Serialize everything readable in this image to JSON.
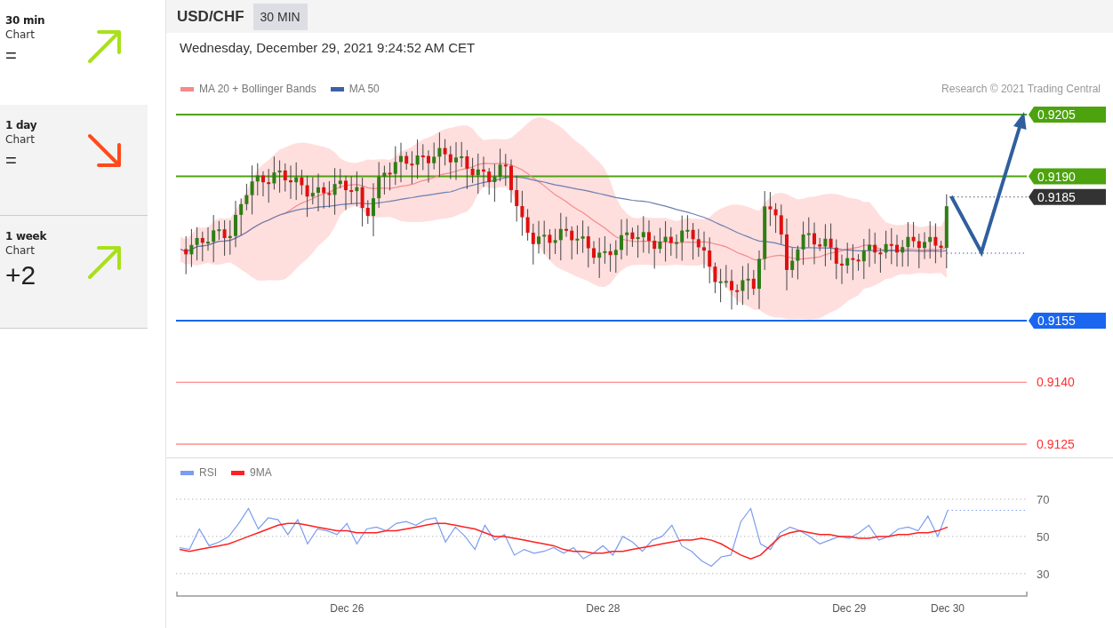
{
  "sidebar": {
    "items": [
      {
        "period": "30 min",
        "label": "Chart",
        "score": "=",
        "kind": "up",
        "selected": true
      },
      {
        "period": "1 day",
        "label": "Chart",
        "score": "=",
        "kind": "down",
        "selected": false
      },
      {
        "period": "1 week",
        "label": "Chart",
        "score": "+2",
        "kind": "up",
        "selected": false
      }
    ]
  },
  "header": {
    "symbol": "USD/CHF",
    "timeframe": "30 MIN"
  },
  "timestamp": "Wednesday, December 29, 2021 9:24:52 AM CET",
  "legend": [
    {
      "label": "MA 20 + Bollinger Bands",
      "color": "#f58a8a"
    },
    {
      "label": "MA 50",
      "color": "#3b62a6"
    }
  ],
  "copyright": "Research © 2021 Trading Central",
  "levels": [
    {
      "label": "0.9205",
      "kind": "tag",
      "color": "#4ca30d"
    },
    {
      "label": "0.9190",
      "kind": "tag",
      "color": "#4ca30d"
    },
    {
      "label": "0.9185",
      "kind": "current",
      "color": "#333333"
    },
    {
      "label": "0.9155",
      "kind": "tag",
      "color": "#1a66f0"
    },
    {
      "label": "0.9140",
      "kind": "plain",
      "color": "#ff3030"
    },
    {
      "label": "0.9125",
      "kind": "plain",
      "color": "#ff3030"
    }
  ],
  "rsi": {
    "chart_data": {
      "type": "line",
      "yticks": [
        30,
        50,
        70
      ],
      "ylim": [
        18,
        70
      ],
      "grid": true,
      "legend": true,
      "categories": [
        null,
        null,
        null,
        null,
        null,
        null,
        null,
        null,
        null,
        null,
        null,
        null,
        null,
        null,
        null,
        null,
        null,
        "Dec 26",
        null,
        null,
        null,
        null,
        null,
        null,
        null,
        null,
        null,
        null,
        null,
        null,
        null,
        null,
        null,
        null,
        null,
        null,
        null,
        null,
        null,
        null,
        null,
        null,
        null,
        "Dec 28",
        null,
        null,
        null,
        null,
        null,
        null,
        null,
        null,
        null,
        null,
        null,
        null,
        null,
        null,
        null,
        null,
        null,
        null,
        null,
        null,
        null,
        null,
        null,
        null,
        "Dec 29",
        null,
        null,
        null,
        null,
        null,
        null,
        null,
        null,
        null,
        "Dec 30"
      ],
      "series": [
        {
          "name": "RSI",
          "color": "#7b9cf0",
          "values": [
            44,
            43,
            54,
            45,
            47,
            50,
            57,
            65,
            54,
            60,
            59,
            51,
            59,
            46,
            54,
            53,
            51,
            57,
            46,
            54,
            55,
            53,
            57,
            58,
            56,
            59,
            60,
            47,
            55,
            50,
            43,
            56,
            48,
            51,
            40,
            43,
            41,
            42,
            44,
            41,
            44,
            38,
            41,
            45,
            40,
            50,
            47,
            42,
            48,
            50,
            56,
            45,
            42,
            37,
            34,
            39,
            40,
            58,
            65,
            46,
            43,
            52,
            55,
            53,
            50,
            46,
            48,
            50,
            49,
            52,
            56,
            48,
            50,
            54,
            55,
            53,
            61,
            50,
            64
          ]
        },
        {
          "name": "9MA",
          "color": "#ff2020",
          "values": [
            43,
            42,
            43,
            44,
            45,
            46,
            48,
            50,
            52,
            54,
            56,
            57,
            57,
            56,
            55,
            54,
            53,
            53,
            52,
            52,
            52,
            53,
            53,
            54,
            55,
            56,
            57,
            57,
            56,
            55,
            54,
            52,
            50,
            50,
            49,
            48,
            47,
            46,
            45,
            43,
            42,
            42,
            41,
            41,
            42,
            42,
            43,
            44,
            45,
            46,
            47,
            48,
            48,
            49,
            48,
            46,
            43,
            40,
            38,
            40,
            45,
            50,
            52,
            53,
            52,
            51,
            51,
            50,
            50,
            49,
            49,
            50,
            50,
            51,
            51,
            52,
            52,
            53,
            55
          ]
        }
      ]
    }
  }
}
